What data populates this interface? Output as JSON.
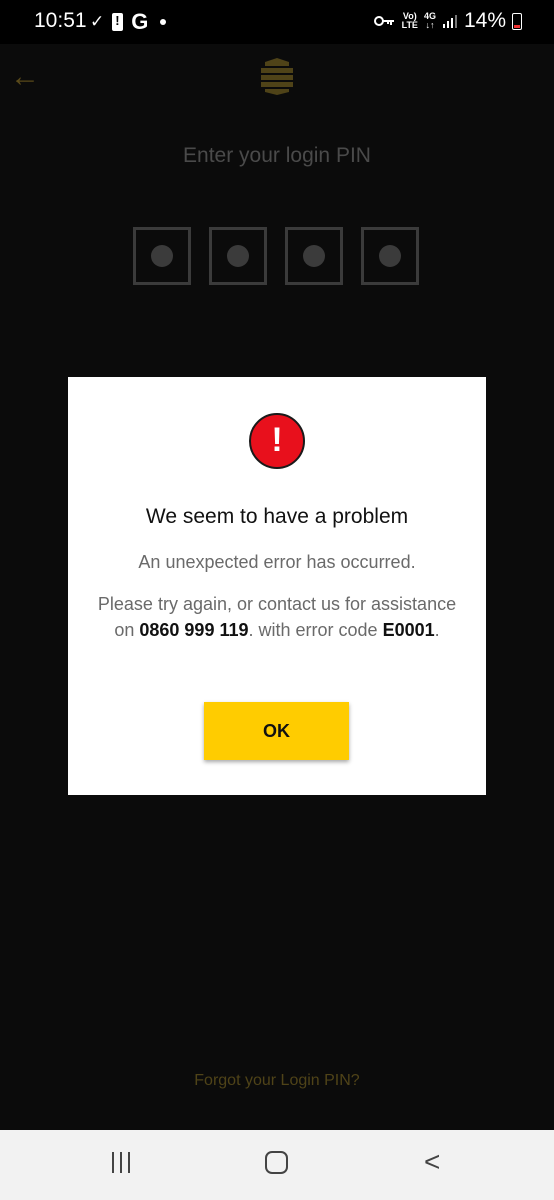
{
  "status_bar": {
    "time": "10:51",
    "g_label": "G",
    "network_top": "Vo)",
    "network_bottom": "LTE",
    "net_4g_top": "4G",
    "net_4g_bottom": "↓↑",
    "battery_percent": "14%"
  },
  "screen": {
    "title": "Enter your login PIN",
    "pin_length": 4,
    "forgot_link": "Forgot your Login PIN?"
  },
  "dialog": {
    "icon_glyph": "!",
    "title": "We seem to have a problem",
    "message": "An unexpected error has occurred.",
    "body_prefix": "Please try again, or contact us for assistance on ",
    "phone": "0860 999 119",
    "body_mid": ". with error code ",
    "error_code": "E0001",
    "body_suffix": ".",
    "ok_label": "OK",
    "accent_color": "#ffcc00",
    "icon_color": "#e8101c"
  }
}
